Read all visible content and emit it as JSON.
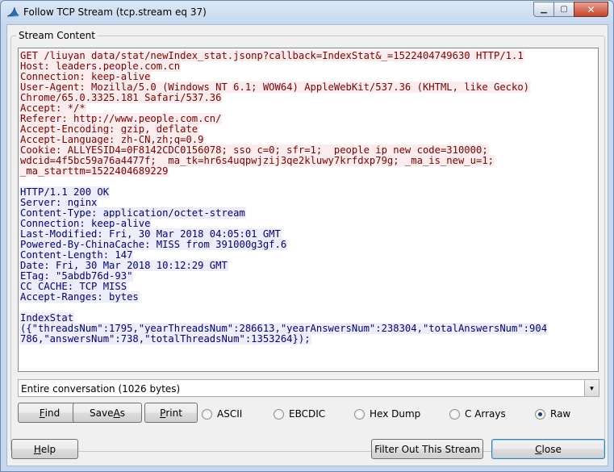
{
  "window": {
    "title": "Follow TCP Stream (tcp.stream eq 37)",
    "controls": {
      "minimize": "▁",
      "maximize": "▢",
      "close": "✕"
    }
  },
  "group_label": "Stream Content",
  "stream_lines": [
    {
      "dir": "client",
      "text": "GET /liuyan_data/stat/newIndex_stat.jsonp?callback=IndexStat&_=1522404749630 HTTP/1.1"
    },
    {
      "dir": "client",
      "text": "Host: leaders.people.com.cn"
    },
    {
      "dir": "client",
      "text": "Connection: keep-alive"
    },
    {
      "dir": "client",
      "text": "User-Agent: Mozilla/5.0 (Windows NT 6.1; WOW64) AppleWebKit/537.36 (KHTML, like Gecko)"
    },
    {
      "dir": "client",
      "text": "Chrome/65.0.3325.181 Safari/537.36"
    },
    {
      "dir": "client",
      "text": "Accept: */*"
    },
    {
      "dir": "client",
      "text": "Referer: http://www.people.com.cn/"
    },
    {
      "dir": "client",
      "text": "Accept-Encoding: gzip, deflate"
    },
    {
      "dir": "client",
      "text": "Accept-Language: zh-CN,zh;q=0.9"
    },
    {
      "dir": "client",
      "text": "Cookie: ALLYESID4=0F8142CDC0156078; sso_c=0; sfr=1; _people_ip_new_code=310000;"
    },
    {
      "dir": "client",
      "text": "wdcid=4f5bc59a76a4477f; _ma_tk=hr6s4uqpwjzij3qe2kluwy7krfdxp79g; _ma_is_new_u=1;"
    },
    {
      "dir": "client",
      "text": "_ma_starttm=1522404689229"
    },
    {
      "dir": "blank",
      "text": ""
    },
    {
      "dir": "server",
      "text": "HTTP/1.1 200 OK"
    },
    {
      "dir": "server",
      "text": "Server: nginx"
    },
    {
      "dir": "server",
      "text": "Content-Type: application/octet-stream"
    },
    {
      "dir": "server",
      "text": "Connection: keep-alive"
    },
    {
      "dir": "server",
      "text": "Last-Modified: Fri, 30 Mar 2018 04:05:01 GMT"
    },
    {
      "dir": "server",
      "text": "Powered-By-ChinaCache: MISS from 391000g3gf.6"
    },
    {
      "dir": "server",
      "text": "Content-Length: 147"
    },
    {
      "dir": "server",
      "text": "Date: Fri, 30 Mar 2018 10:12:29 GMT"
    },
    {
      "dir": "server",
      "text": "ETag: \"5abdb76d-93\""
    },
    {
      "dir": "server",
      "text": "CC_CACHE: TCP_MISS"
    },
    {
      "dir": "server",
      "text": "Accept-Ranges: bytes"
    },
    {
      "dir": "blank",
      "text": ""
    },
    {
      "dir": "server",
      "text": "IndexStat"
    },
    {
      "dir": "server",
      "text": "({\"threadsNum\":1795,\"yearThreadsNum\":286613,\"yearAnswersNum\":238304,\"totalAnswersNum\":904"
    },
    {
      "dir": "server",
      "text": "786,\"answersNum\":738,\"totalThreadsNum\":1353264});"
    }
  ],
  "conversation_select": {
    "value": "Entire conversation (1026 bytes)"
  },
  "buttons": {
    "find": {
      "mnemonic": "F",
      "rest": "ind"
    },
    "save_as": {
      "pre": "Save ",
      "mnemonic": "A",
      "rest": "s"
    },
    "print": {
      "mnemonic": "P",
      "rest": "rint"
    },
    "help": {
      "mnemonic": "H",
      "rest": "elp"
    },
    "filter_out": "Filter Out This Stream",
    "close": {
      "mnemonic": "C",
      "rest": "lose"
    }
  },
  "formats": [
    {
      "label": "ASCII",
      "checked": false
    },
    {
      "label": "EBCDIC",
      "checked": false
    },
    {
      "label": "Hex Dump",
      "checked": false
    },
    {
      "label": "C Arrays",
      "checked": false
    },
    {
      "label": "Raw",
      "checked": true
    }
  ],
  "colors": {
    "client_bg": "#fbeded",
    "client_fg": "#7f0000",
    "server_bg": "#ededfb",
    "server_fg": "#00007f"
  }
}
